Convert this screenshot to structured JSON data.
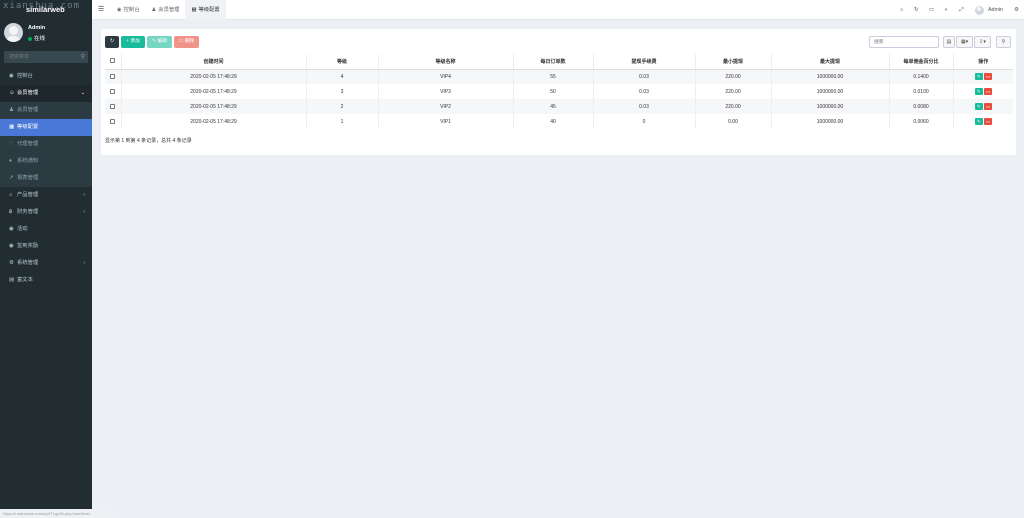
{
  "watermark": "xianshua.com",
  "brand": "similarweb",
  "user": {
    "name": "Admin",
    "status": "在线"
  },
  "search": {
    "placeholder": "搜索菜单"
  },
  "sidebar": {
    "items": [
      {
        "label": "控制台",
        "icon": "dashboard-icon"
      },
      {
        "label": "会员管理",
        "icon": "user-circle-icon"
      },
      {
        "label": "会员管理",
        "icon": "user-icon"
      },
      {
        "label": "等级配置",
        "icon": "table-icon"
      },
      {
        "label": "代理管理",
        "icon": "sitemap-icon"
      },
      {
        "label": "系统通知",
        "icon": "bell-icon"
      },
      {
        "label": "报表管理",
        "icon": "chart-icon"
      },
      {
        "label": "产品管理",
        "icon": "home-icon"
      },
      {
        "label": "财务管理",
        "icon": "bitcoin-icon"
      },
      {
        "label": "活动",
        "icon": "gamepad-icon"
      },
      {
        "label": "签到奖励",
        "icon": "gamepad-icon"
      },
      {
        "label": "系统管理",
        "icon": "cogs-icon"
      },
      {
        "label": "富文本",
        "icon": "list-icon"
      }
    ]
  },
  "footer_url": "https://r.xianshua.com/uqXT1qp46.php/user/level",
  "tabs": [
    {
      "label": "控制台",
      "icon": "dashboard-icon"
    },
    {
      "label": "会员管理",
      "icon": "user-icon"
    },
    {
      "label": "等级配置",
      "icon": "table-icon"
    }
  ],
  "topbar": {
    "admin_name": "Admin"
  },
  "toolbar": {
    "add_label": "添加",
    "edit_label": "编辑",
    "delete_label": "删除",
    "search_placeholder": "搜索"
  },
  "table": {
    "columns": [
      "创建时间",
      "等级",
      "等级名称",
      "每日订单数",
      "提现手续费",
      "最小提现",
      "最大提现",
      "每单佣金百分比",
      "操作"
    ],
    "rows": [
      [
        "2020-02-05 17:48:29",
        "4",
        "VIP4",
        "55",
        "0.03",
        "220.00",
        "1000000.00",
        "0.1400"
      ],
      [
        "2020-02-05 17:48:29",
        "3",
        "VIP3",
        "50",
        "0.03",
        "220.00",
        "1000000.00",
        "0.0100"
      ],
      [
        "2020-02-05 17:48:29",
        "2",
        "VIP2",
        "45",
        "0.03",
        "220.00",
        "1000000.00",
        "0.0080"
      ],
      [
        "2020-02-05 17:48:29",
        "1",
        "VIP1",
        "40",
        "0",
        "0.00",
        "1000000.00",
        "0.0060"
      ]
    ]
  },
  "pager": {
    "text": "显示第 1 到第 4 条记录，总共 4 条记录"
  },
  "colors": {
    "sidebar_bg": "#222d32",
    "active_item": "#4a78d8",
    "success": "#18bc9c",
    "danger": "#e74c3c"
  }
}
